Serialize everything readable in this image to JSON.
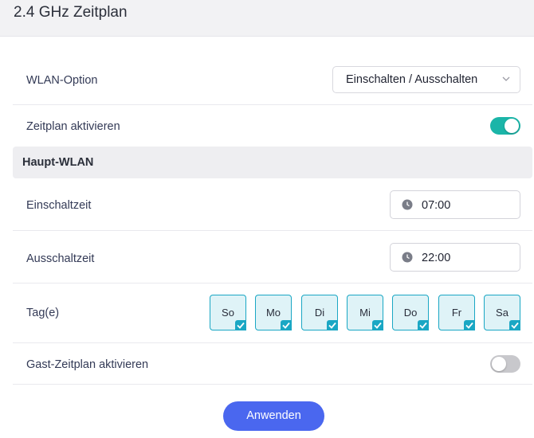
{
  "header": {
    "title": "2.4 GHz Zeitplan"
  },
  "wlan_option": {
    "label": "WLAN-Option",
    "value": "Einschalten / Ausschalten"
  },
  "schedule": {
    "label": "Zeitplan aktivieren",
    "enabled": true
  },
  "main_wlan": {
    "title": "Haupt-WLAN",
    "on_time": {
      "label": "Einschaltzeit",
      "value": "07:00"
    },
    "off_time": {
      "label": "Ausschaltzeit",
      "value": "22:00"
    },
    "days": {
      "label": "Tag(e)",
      "items": [
        {
          "label": "So",
          "checked": true
        },
        {
          "label": "Mo",
          "checked": true
        },
        {
          "label": "Di",
          "checked": true
        },
        {
          "label": "Mi",
          "checked": true
        },
        {
          "label": "Do",
          "checked": true
        },
        {
          "label": "Fr",
          "checked": true
        },
        {
          "label": "Sa",
          "checked": true
        }
      ]
    }
  },
  "guest_schedule": {
    "label": "Gast-Zeitplan aktivieren",
    "enabled": false
  },
  "apply_button": {
    "label": "Anwenden"
  },
  "colors": {
    "accent": "#1bb5a8",
    "primary_button": "#4a67ef",
    "day_border": "#1aa7c4",
    "toggle_off": "#c8c8cc"
  }
}
